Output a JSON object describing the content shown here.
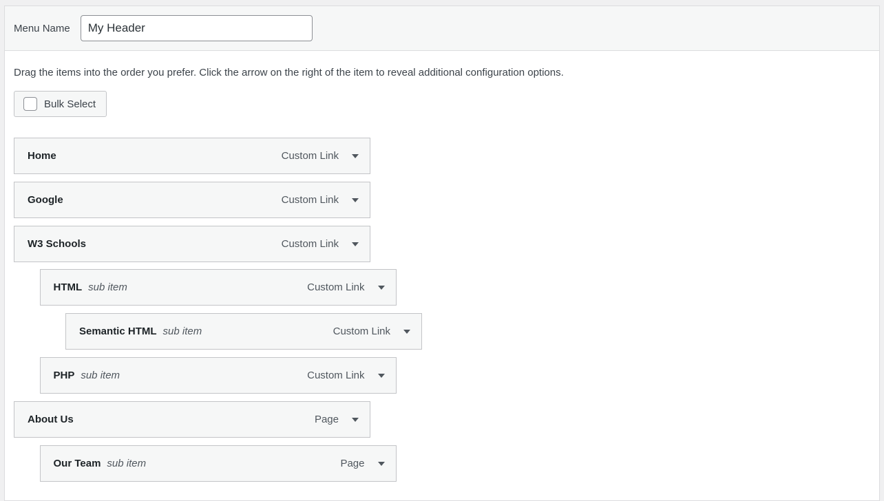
{
  "header": {
    "menu_name_label": "Menu Name",
    "menu_name_value": "My Header"
  },
  "instructions": "Drag the items into the order you prefer. Click the arrow on the right of the item to reveal additional configuration options.",
  "bulk_select": {
    "label": "Bulk Select",
    "checked": false
  },
  "menu_items": [
    {
      "title": "Home",
      "sub": "",
      "type": "Custom Link",
      "depth": 0
    },
    {
      "title": "Google",
      "sub": "",
      "type": "Custom Link",
      "depth": 0
    },
    {
      "title": "W3 Schools",
      "sub": "",
      "type": "Custom Link",
      "depth": 0
    },
    {
      "title": "HTML",
      "sub": "sub item",
      "type": "Custom Link",
      "depth": 1
    },
    {
      "title": "Semantic HTML",
      "sub": "sub item",
      "type": "Custom Link",
      "depth": 2
    },
    {
      "title": "PHP",
      "sub": "sub item",
      "type": "Custom Link",
      "depth": 1
    },
    {
      "title": "About Us",
      "sub": "",
      "type": "Page",
      "depth": 0
    },
    {
      "title": "Our Team",
      "sub": "sub item",
      "type": "Page",
      "depth": 1
    }
  ],
  "icons": {
    "expand": "triangle-down-icon",
    "checkbox": "checkbox-icon"
  },
  "colors": {
    "item_bg": "#f6f7f7",
    "border": "#c3c4c7",
    "text": "#1d2327",
    "muted": "#50575e"
  }
}
